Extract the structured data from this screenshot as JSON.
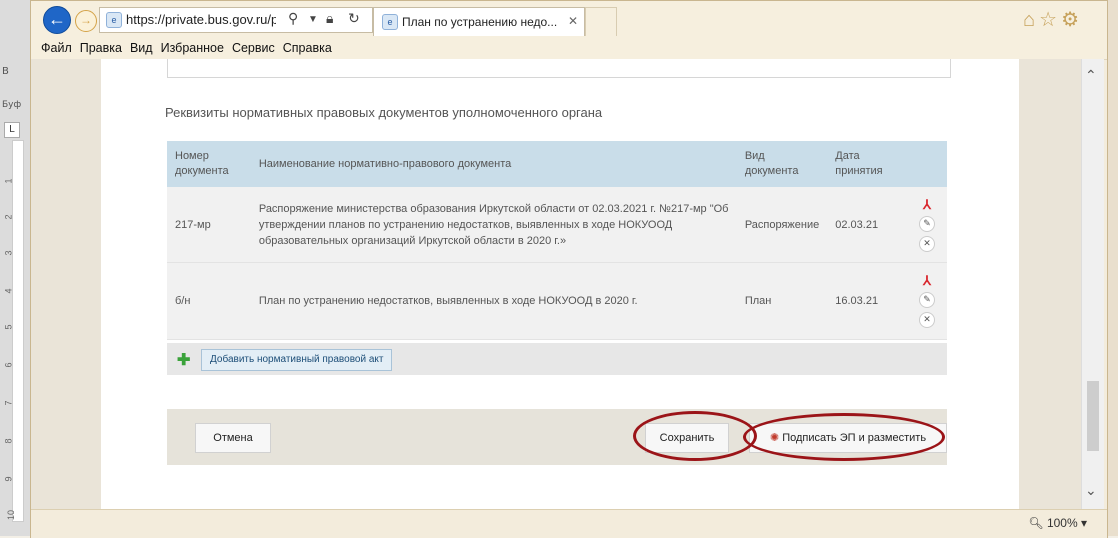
{
  "word": {
    "left_labels": [
      "B",
      "Буф"
    ],
    "ruler_marker": "L",
    "ruler_numbers": [
      "1",
      "2",
      "3",
      "4",
      "5",
      "6",
      "7",
      "8",
      "9",
      "10"
    ]
  },
  "browser": {
    "url": "https://private.bus.gov.ru/priv",
    "tab_title": "План по устранению недо...",
    "menu": [
      "Файл",
      "Правка",
      "Вид",
      "Избранное",
      "Сервис",
      "Справка"
    ],
    "zoom": "100%"
  },
  "page": {
    "section_title": "Реквизиты нормативных правовых документов уполномоченного органа",
    "table": {
      "headers": [
        "Номер документа",
        "Наименование нормативно-правового документа",
        "Вид документа",
        "Дата принятия"
      ],
      "rows": [
        {
          "number": "217-мр",
          "name": "Распоряжение министерства образования Иркутской области от 02.03.2021 г. №217-мр \"Об утверждении планов по устранению недостатков, выявленных в ходе НОКУООД образовательных организаций Иркутской области в 2020 г.»",
          "type": "Распоряжение",
          "date": "02.03.21"
        },
        {
          "number": "б/н",
          "name": "План по устранению недостатков, выявленных в ходе НОКУООД в 2020 г.",
          "type": "План",
          "date": "16.03.21"
        }
      ]
    },
    "add_button": "Добавить нормативный правовой акт",
    "cancel_button": "Отмена",
    "save_button": "Сохранить",
    "sign_button": "Подписать ЭП и разместить"
  },
  "colors": {
    "table_header": "#c9dde9",
    "highlight_ellipse": "#9b1418",
    "pdf_icon": "#d9282f",
    "add_icon": "#3aa23a"
  },
  "icons": [
    "back-arrow-icon",
    "forward-arrow-icon",
    "search-icon",
    "lock-icon",
    "refresh-icon",
    "home-icon",
    "star-icon",
    "gear-icon",
    "pdf-icon",
    "edit-icon",
    "delete-icon",
    "plus-icon",
    "signature-icon",
    "zoom-icon"
  ]
}
